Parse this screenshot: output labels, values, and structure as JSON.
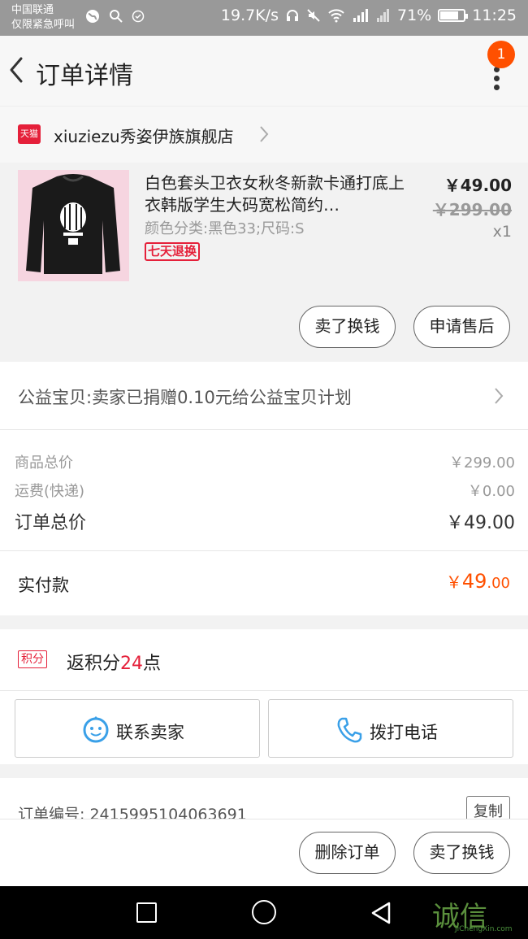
{
  "status_bar": {
    "carrier_line1": "中国联通",
    "carrier_line2": "仅限紧急呼叫",
    "speed": "19.7K/s",
    "battery": "71%",
    "battery_level": 0.71,
    "time": "11:25"
  },
  "nav": {
    "title": "订单详情",
    "badge": "1"
  },
  "store": {
    "badge_text": "天猫",
    "name": "xiuziezu秀姿伊族旗舰店"
  },
  "product": {
    "title": "白色套头卫衣女秋冬新款卡通打底上衣韩版学生大码宽松简约…",
    "sku": "颜色分类:黑色33;尺码:S",
    "tag": "七天退换",
    "price": "￥49.00",
    "original_price": "￥299.00",
    "quantity": "x1",
    "actions": [
      "卖了换钱",
      "申请售后"
    ]
  },
  "charity": {
    "text": "公益宝贝:卖家已捐赠0.10元给公益宝贝计划"
  },
  "totals": {
    "goods_label": "商品总价",
    "goods_value": "￥299.00",
    "shipping_label": "运费(快递)",
    "shipping_value": "￥0.00",
    "order_label": "订单总价",
    "order_value": "￥49.00"
  },
  "paid": {
    "label": "实付款",
    "currency": "￥",
    "integer": "49",
    "decimal": ".00"
  },
  "points": {
    "tag": "积分",
    "prefix": "返积分",
    "value": "24",
    "suffix": "点"
  },
  "contact": {
    "seller": "联系卖家",
    "phone": "拨打电话"
  },
  "order": {
    "number_text": "订单编号: 2415995104063691",
    "copy": "复制"
  },
  "bottom_actions": {
    "delete": "删除订单",
    "sell": "卖了换钱"
  },
  "watermark": {
    "text": "诚信",
    "sub": "JiChengXin.com"
  },
  "colors": {
    "accent": "#ff5000",
    "tmall_red": "#e5203a",
    "contact_blue": "#3aa0e8"
  }
}
